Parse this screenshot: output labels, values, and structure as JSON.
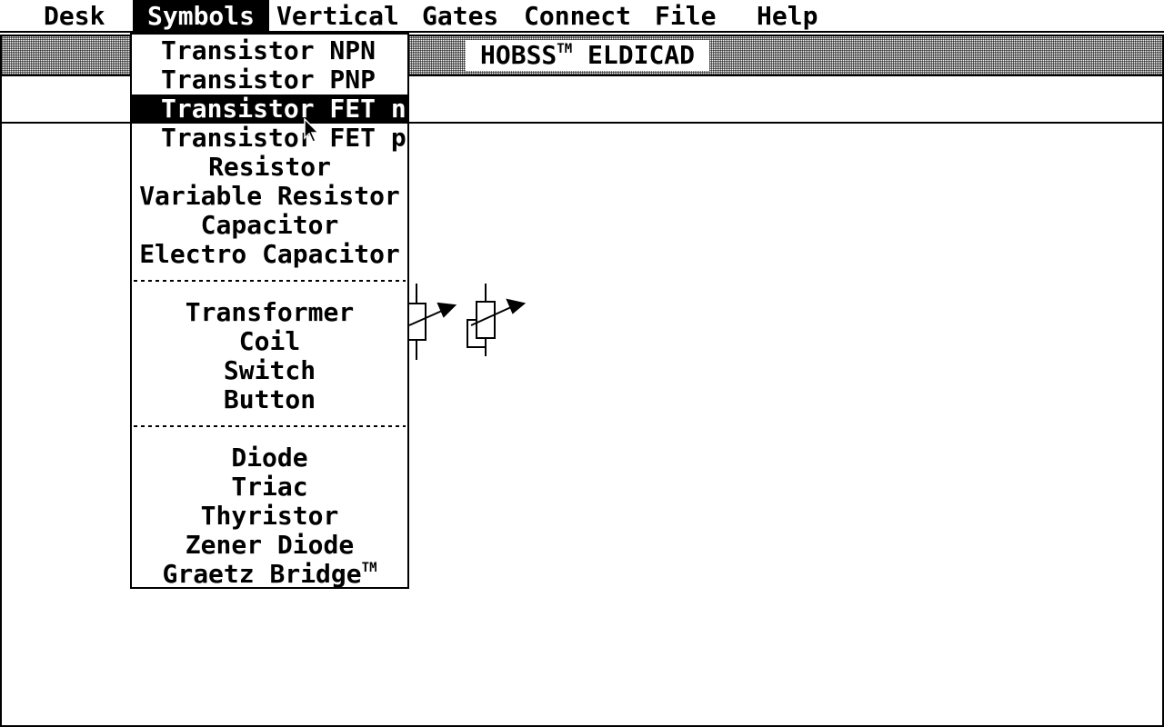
{
  "menubar": {
    "items": [
      {
        "label": "Desk"
      },
      {
        "label": "Symbols",
        "active": true
      },
      {
        "label": "Vertical"
      },
      {
        "label": "Gates"
      },
      {
        "label": "Connect"
      },
      {
        "label": "File"
      },
      {
        "label": "Help"
      }
    ]
  },
  "window": {
    "title": "HOBSS",
    "title_tm": "TM",
    "title_suffix": " ELDICAD"
  },
  "symbols_menu": {
    "items": [
      {
        "label": "Transistor NPN"
      },
      {
        "label": "Transistor PNP"
      },
      {
        "label": "Transistor FET n",
        "highlighted": true
      },
      {
        "label": "Transistor FET p"
      },
      {
        "label": "Resistor"
      },
      {
        "label": "Variable Resistor"
      },
      {
        "label": "Capacitor"
      },
      {
        "label": "Electro Capacitor"
      },
      {
        "label": "Transformer"
      },
      {
        "label": "Coil"
      },
      {
        "label": "Switch"
      },
      {
        "label": "Button"
      },
      {
        "label": "Diode"
      },
      {
        "label": "Triac"
      },
      {
        "label": "Thyristor"
      },
      {
        "label": "Zener Diode"
      },
      {
        "label": "Graetz Bridge"
      }
    ],
    "graetz_tm": "TM"
  },
  "colors": {
    "foreground": "#000000",
    "background": "#ffffff"
  }
}
